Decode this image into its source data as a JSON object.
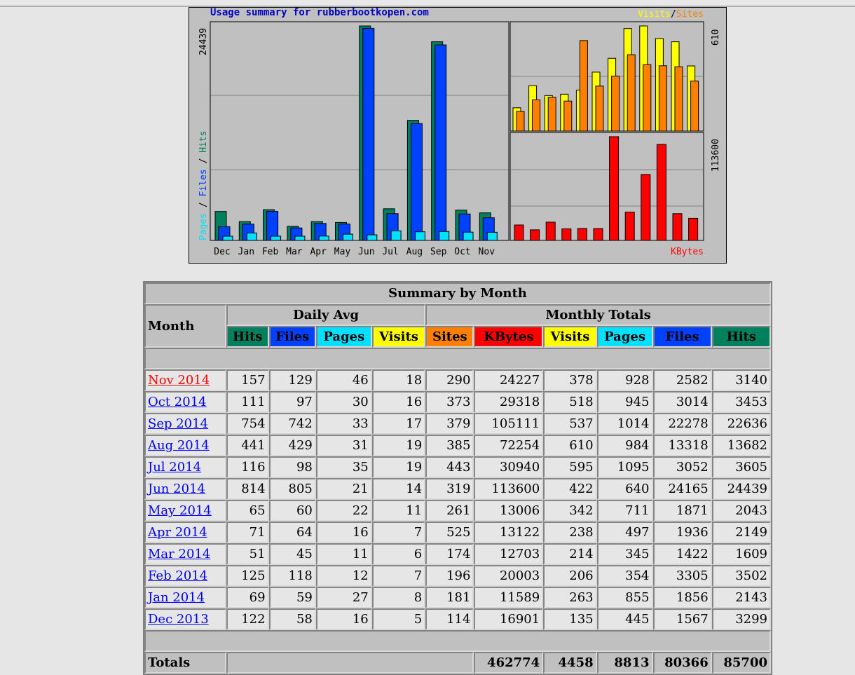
{
  "graph": {
    "title": "Usage summary for rubberbootkopen.com",
    "legend_visits": "Visits",
    "legend_sep": "/",
    "legend_sites": "Sites",
    "left_ylabel_pages": "Pages",
    "left_ylabel_files": "Files",
    "left_ylabel_hits": "Hits",
    "left_max": "24439",
    "right_top_max": "610",
    "right_bottom_max": "113600",
    "kbytes_label": "KBytes",
    "colors": {
      "hits": "#00805c",
      "files": "#0040ff",
      "pages": "#00e0ff",
      "visits": "#ffff00",
      "sites": "#ff8000",
      "kbytes": "#ff0000"
    }
  },
  "chart_data": {
    "type": "bar",
    "categories": [
      "Dec",
      "Jan",
      "Feb",
      "Mar",
      "Apr",
      "May",
      "Jun",
      "Jul",
      "Aug",
      "Sep",
      "Oct",
      "Nov"
    ],
    "series": [
      {
        "name": "Hits",
        "values": [
          3299,
          2143,
          3502,
          1609,
          2149,
          2043,
          24439,
          3605,
          13682,
          22636,
          3453,
          3140
        ]
      },
      {
        "name": "Files",
        "values": [
          1567,
          1856,
          3305,
          1422,
          1936,
          1871,
          24165,
          3052,
          13318,
          22278,
          3014,
          2582
        ]
      },
      {
        "name": "Pages",
        "values": [
          445,
          855,
          354,
          345,
          497,
          711,
          640,
          1095,
          984,
          1014,
          945,
          928
        ]
      },
      {
        "name": "Visits",
        "values": [
          135,
          263,
          206,
          214,
          238,
          342,
          422,
          595,
          610,
          537,
          518,
          378
        ]
      },
      {
        "name": "Sites",
        "values": [
          114,
          181,
          196,
          174,
          525,
          261,
          319,
          443,
          385,
          379,
          373,
          290
        ]
      },
      {
        "name": "KBytes",
        "values": [
          16901,
          11589,
          20003,
          12703,
          13122,
          13006,
          113600,
          30940,
          72254,
          105111,
          29318,
          24227
        ]
      }
    ]
  },
  "table": {
    "title": "Summary by Month",
    "month_header": "Month",
    "daily_avg": "Daily Avg",
    "monthly_totals": "Monthly Totals",
    "cols_daily": [
      "Hits",
      "Files",
      "Pages",
      "Visits"
    ],
    "cols_monthly": [
      "Sites",
      "KBytes",
      "Visits",
      "Pages",
      "Files",
      "Hits"
    ],
    "rows": [
      {
        "month": "Nov 2014",
        "d_hits": "157",
        "d_files": "129",
        "d_pages": "46",
        "d_visits": "18",
        "sites": "290",
        "kbytes": "24227",
        "visits": "378",
        "pages": "928",
        "files": "2582",
        "hits": "3140"
      },
      {
        "month": "Oct 2014",
        "d_hits": "111",
        "d_files": "97",
        "d_pages": "30",
        "d_visits": "16",
        "sites": "373",
        "kbytes": "29318",
        "visits": "518",
        "pages": "945",
        "files": "3014",
        "hits": "3453"
      },
      {
        "month": "Sep 2014",
        "d_hits": "754",
        "d_files": "742",
        "d_pages": "33",
        "d_visits": "17",
        "sites": "379",
        "kbytes": "105111",
        "visits": "537",
        "pages": "1014",
        "files": "22278",
        "hits": "22636"
      },
      {
        "month": "Aug 2014",
        "d_hits": "441",
        "d_files": "429",
        "d_pages": "31",
        "d_visits": "19",
        "sites": "385",
        "kbytes": "72254",
        "visits": "610",
        "pages": "984",
        "files": "13318",
        "hits": "13682"
      },
      {
        "month": "Jul 2014",
        "d_hits": "116",
        "d_files": "98",
        "d_pages": "35",
        "d_visits": "19",
        "sites": "443",
        "kbytes": "30940",
        "visits": "595",
        "pages": "1095",
        "files": "3052",
        "hits": "3605"
      },
      {
        "month": "Jun 2014",
        "d_hits": "814",
        "d_files": "805",
        "d_pages": "21",
        "d_visits": "14",
        "sites": "319",
        "kbytes": "113600",
        "visits": "422",
        "pages": "640",
        "files": "24165",
        "hits": "24439"
      },
      {
        "month": "May 2014",
        "d_hits": "65",
        "d_files": "60",
        "d_pages": "22",
        "d_visits": "11",
        "sites": "261",
        "kbytes": "13006",
        "visits": "342",
        "pages": "711",
        "files": "1871",
        "hits": "2043"
      },
      {
        "month": "Apr 2014",
        "d_hits": "71",
        "d_files": "64",
        "d_pages": "16",
        "d_visits": "7",
        "sites": "525",
        "kbytes": "13122",
        "visits": "238",
        "pages": "497",
        "files": "1936",
        "hits": "2149"
      },
      {
        "month": "Mar 2014",
        "d_hits": "51",
        "d_files": "45",
        "d_pages": "11",
        "d_visits": "6",
        "sites": "174",
        "kbytes": "12703",
        "visits": "214",
        "pages": "345",
        "files": "1422",
        "hits": "1609"
      },
      {
        "month": "Feb 2014",
        "d_hits": "125",
        "d_files": "118",
        "d_pages": "12",
        "d_visits": "7",
        "sites": "196",
        "kbytes": "20003",
        "visits": "206",
        "pages": "354",
        "files": "3305",
        "hits": "3502"
      },
      {
        "month": "Jan 2014",
        "d_hits": "69",
        "d_files": "59",
        "d_pages": "27",
        "d_visits": "8",
        "sites": "181",
        "kbytes": "11589",
        "visits": "263",
        "pages": "855",
        "files": "1856",
        "hits": "2143"
      },
      {
        "month": "Dec 2013",
        "d_hits": "122",
        "d_files": "58",
        "d_pages": "16",
        "d_visits": "5",
        "sites": "114",
        "kbytes": "16901",
        "visits": "135",
        "pages": "445",
        "files": "1567",
        "hits": "3299"
      }
    ],
    "totals_label": "Totals",
    "totals": {
      "kbytes": "462774",
      "visits": "4458",
      "pages": "8813",
      "files": "80366",
      "hits": "85700"
    }
  }
}
